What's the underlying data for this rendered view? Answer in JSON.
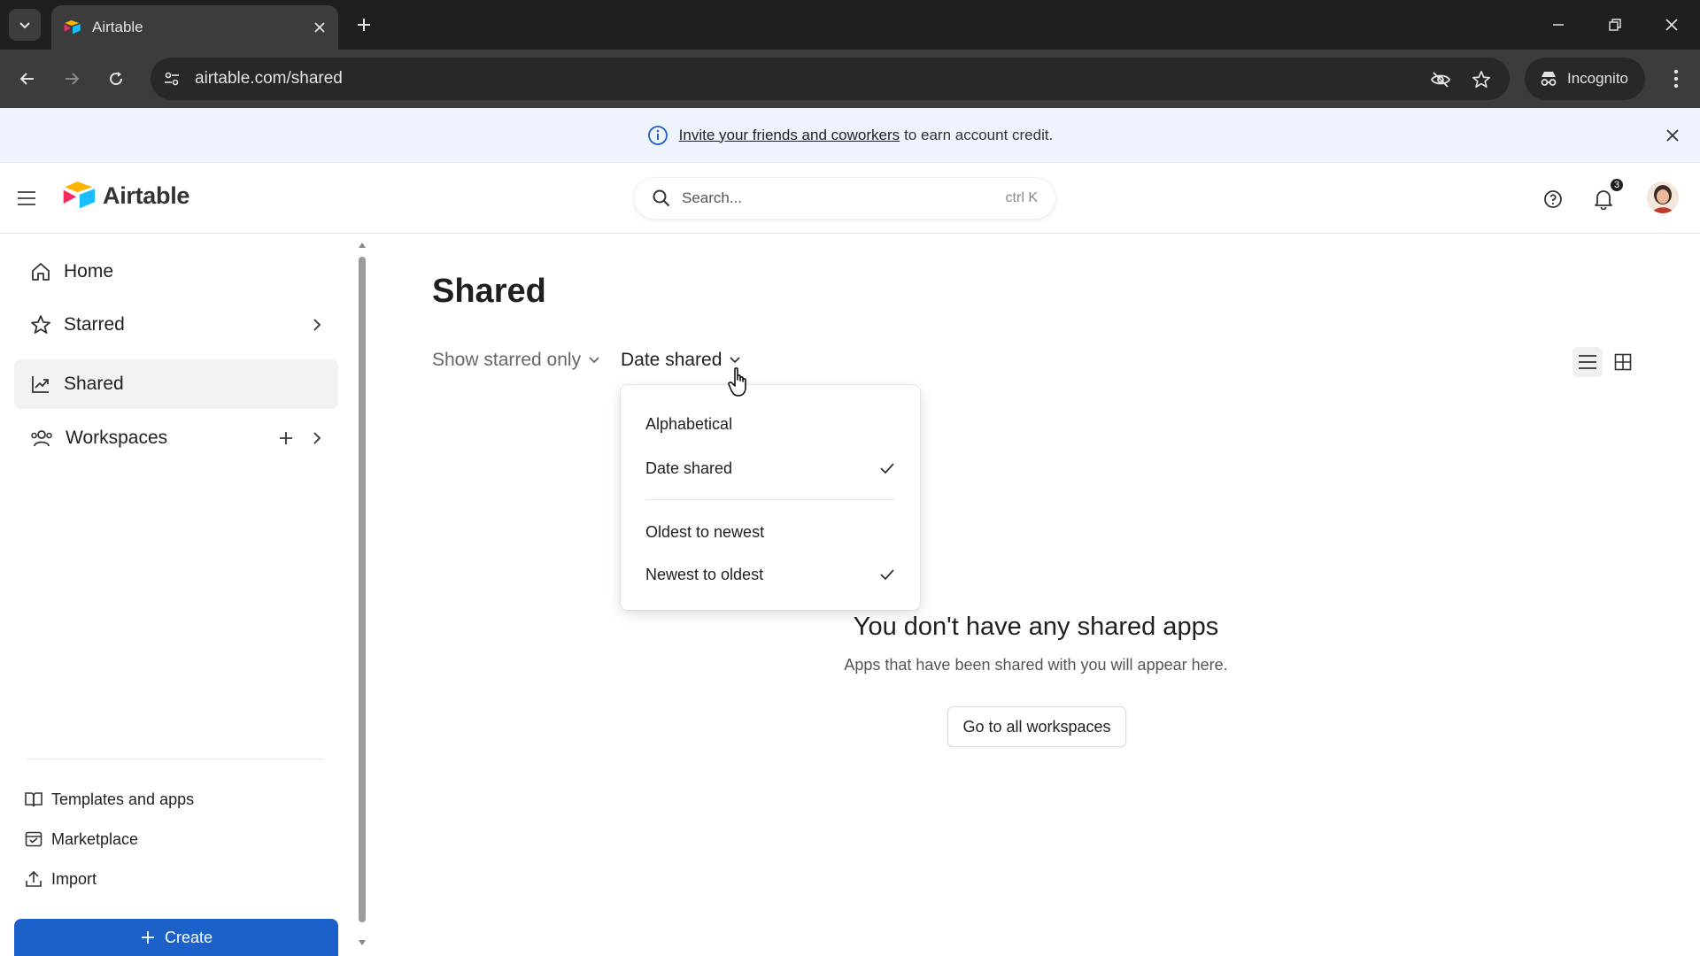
{
  "browser": {
    "tab_title": "Airtable",
    "url": "airtable.com/shared",
    "incognito_label": "Incognito"
  },
  "banner": {
    "link_text": "Invite your friends and coworkers",
    "rest_text": "to earn account credit."
  },
  "header": {
    "logo_text": "Airtable",
    "search_placeholder": "Search...",
    "search_shortcut": "ctrl K",
    "notification_count": "3"
  },
  "sidebar": {
    "items": [
      {
        "label": "Home",
        "icon": "home-icon"
      },
      {
        "label": "Starred",
        "icon": "star-icon"
      },
      {
        "label": "Shared",
        "icon": "shared-icon"
      },
      {
        "label": "Workspaces",
        "icon": "workspaces-icon"
      }
    ],
    "footer": [
      {
        "label": "Templates and apps",
        "icon": "book-icon"
      },
      {
        "label": "Marketplace",
        "icon": "marketplace-icon"
      },
      {
        "label": "Import",
        "icon": "import-icon"
      }
    ],
    "create_label": "Create"
  },
  "main": {
    "title": "Shared",
    "filter_starred": "Show starred only",
    "sort_label": "Date shared",
    "empty_title": "You don't have any shared apps",
    "empty_subtitle": "Apps that have been shared with you will appear here.",
    "go_button": "Go to all workspaces"
  },
  "dropdown": {
    "sort_options": [
      {
        "label": "Alphabetical",
        "checked": false
      },
      {
        "label": "Date shared",
        "checked": true
      }
    ],
    "order_options": [
      {
        "label": "Oldest to newest",
        "checked": false
      },
      {
        "label": "Newest to oldest",
        "checked": true
      }
    ]
  },
  "colors": {
    "accent": "#1b61c9",
    "banner_bg": "#eef3fd",
    "active_nav": "#f2f2f2"
  }
}
